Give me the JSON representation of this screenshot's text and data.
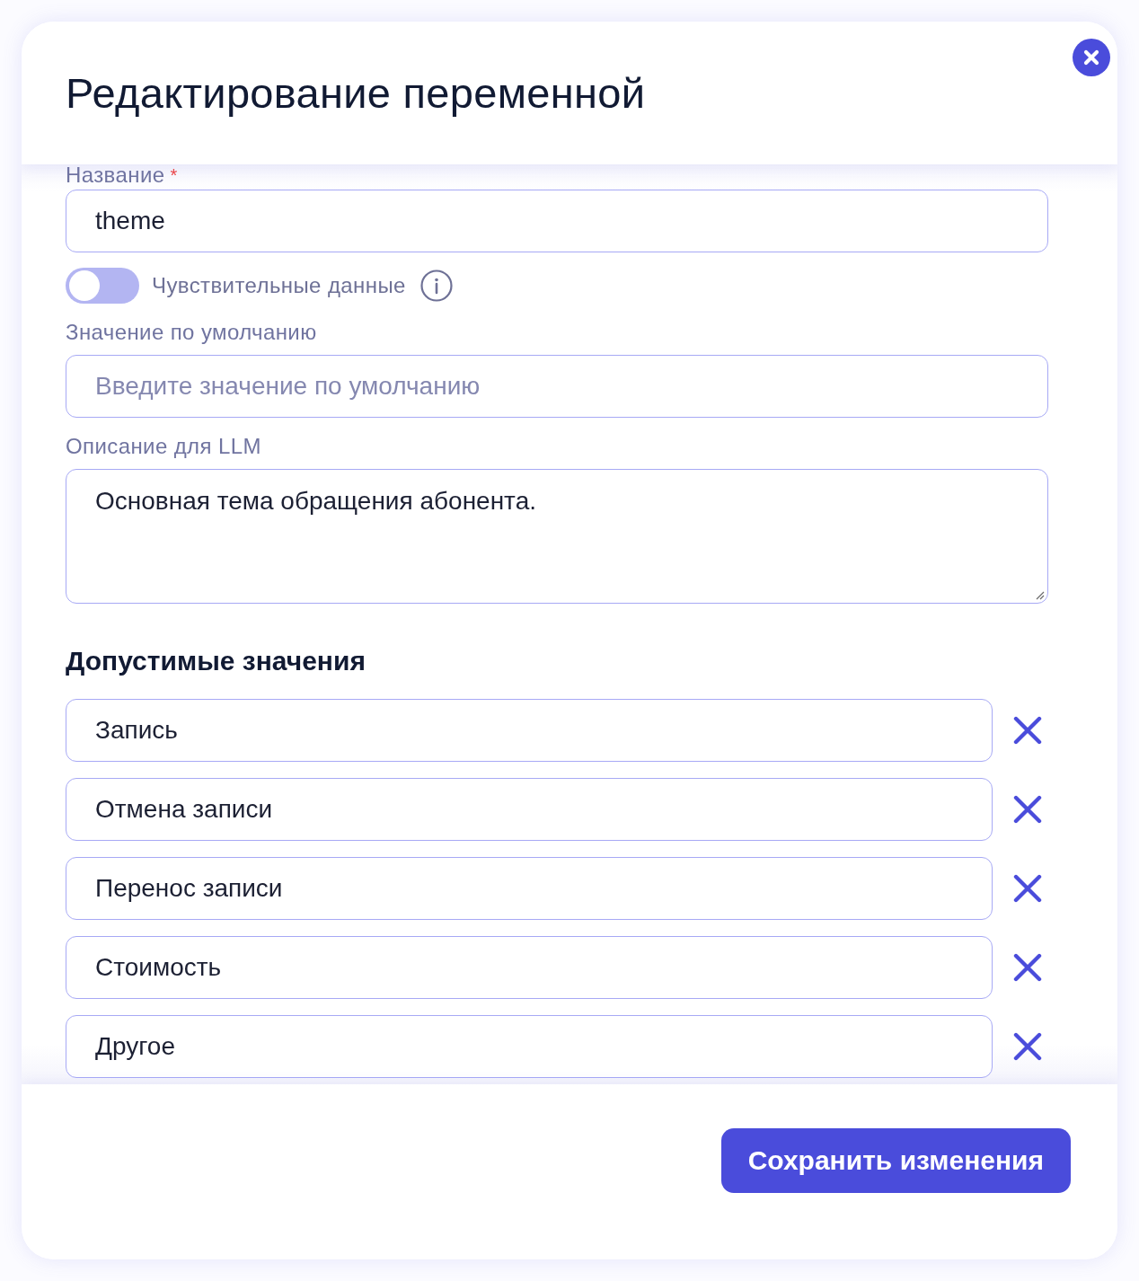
{
  "dialog": {
    "title": "Редактирование переменной"
  },
  "fields": [
    {
      "kind": "text",
      "label": "Название",
      "required_mark": "*",
      "value": "theme"
    },
    {
      "kind": "toggle",
      "label": "Чувствительные данные",
      "on": false
    },
    {
      "kind": "text",
      "label": "Значение по умолчанию",
      "placeholder": "Введите значение по умолчанию"
    },
    {
      "kind": "textarea",
      "label": "Описание для LLM",
      "value": "Основная тема обращения абонента."
    }
  ],
  "allowed_values": {
    "title": "Допустимые значения",
    "items": [
      {
        "value": "Запись"
      },
      {
        "value": "Отмена записи"
      },
      {
        "value": "Перенос записи"
      },
      {
        "value": "Стоимость"
      },
      {
        "value": "Другое"
      }
    ]
  },
  "footer": {
    "save_button": "Сохранить изменения"
  }
}
